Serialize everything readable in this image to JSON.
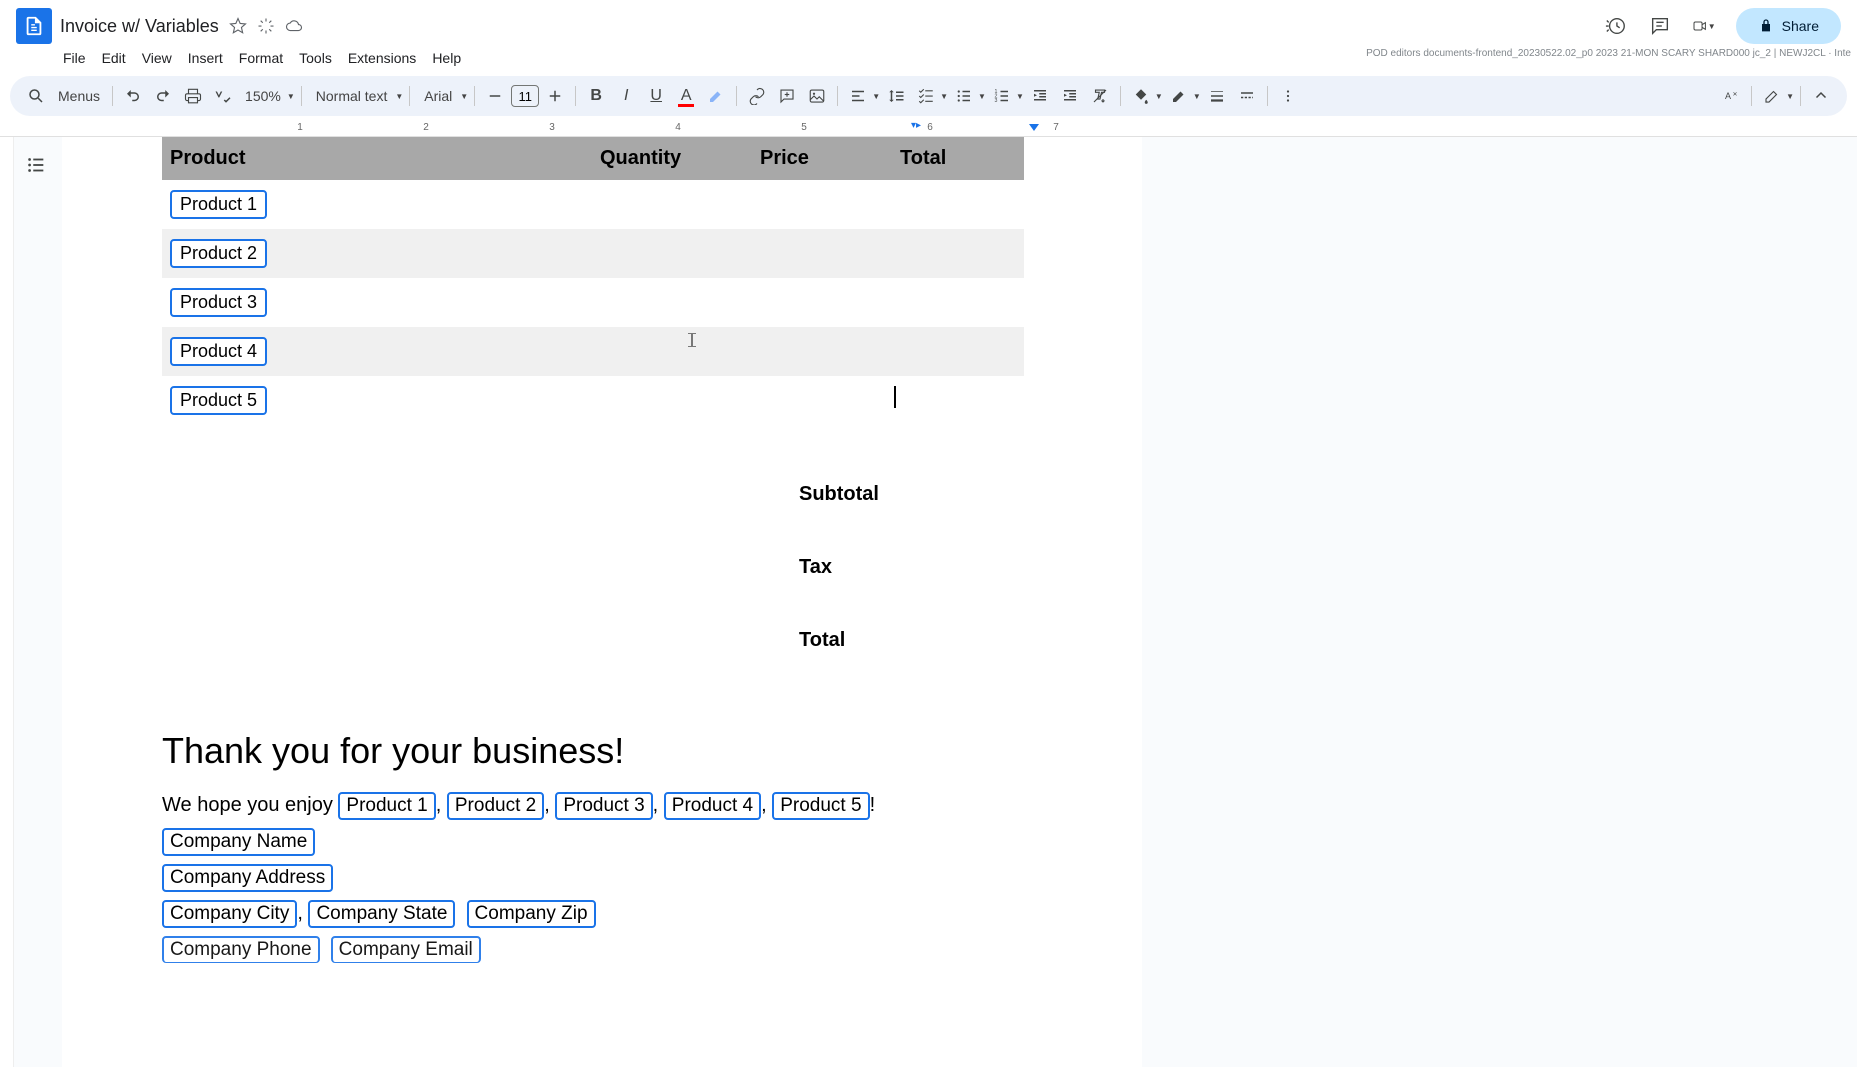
{
  "doc": {
    "title": "Invoice w/ Variables"
  },
  "menu": {
    "file": "File",
    "edit": "Edit",
    "view": "View",
    "insert": "Insert",
    "format": "Format",
    "tools": "Tools",
    "extensions": "Extensions",
    "help": "Help"
  },
  "toolbar": {
    "menus_placeholder": "Menus",
    "zoom": "150%",
    "style": "Normal text",
    "font": "Arial",
    "size": "11",
    "share": "Share"
  },
  "pod": "POD editors documents-frontend_20230522.02_p0 2023 21-MON SCARY SHARD000 jc_2 | NEWJ2CL · Inte",
  "ruler": {
    "n1": "1",
    "n2": "2",
    "n3": "3",
    "n4": "4",
    "n5": "5",
    "n6": "6",
    "n7": "7"
  },
  "invoice": {
    "headers": {
      "product": "Product",
      "quantity": "Quantity",
      "price": "Price",
      "total": "Total"
    },
    "rows": [
      {
        "product": "Product 1"
      },
      {
        "product": "Product 2"
      },
      {
        "product": "Product 3"
      },
      {
        "product": "Product 4"
      },
      {
        "product": "Product 5"
      }
    ],
    "subtotal_label": "Subtotal",
    "tax_label": "Tax",
    "total_label": "Total"
  },
  "thankyou": {
    "heading": "Thank you for your business!",
    "lead": "We hope you enjoy ",
    "p1": "Product 1",
    "p2": "Product 2",
    "p3": "Product 3",
    "p4": "Product 4",
    "p5": "Product 5",
    "tail": "!"
  },
  "company": {
    "name": "Company Name",
    "address": "Company Address",
    "city": "Company City",
    "state": "Company State",
    "zip": "Company Zip",
    "phone": "Company Phone",
    "email": "Company Email"
  },
  "sep": {
    "comma": ", "
  }
}
